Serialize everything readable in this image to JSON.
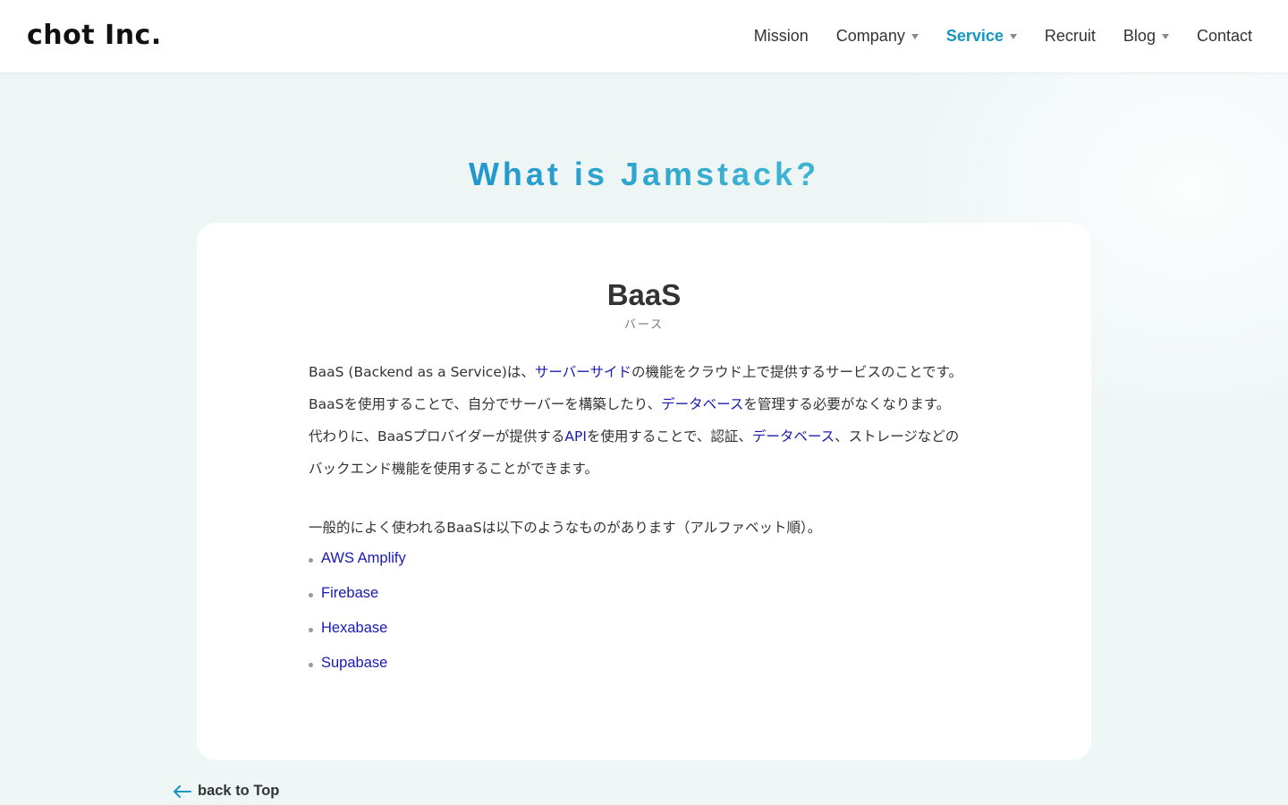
{
  "header": {
    "logo": "chot Inc.",
    "nav": [
      {
        "label": "Mission",
        "has_dropdown": false,
        "active": false
      },
      {
        "label": "Company",
        "has_dropdown": true,
        "active": false
      },
      {
        "label": "Service",
        "has_dropdown": true,
        "active": true
      },
      {
        "label": "Recruit",
        "has_dropdown": false,
        "active": false
      },
      {
        "label": "Blog",
        "has_dropdown": true,
        "active": false
      },
      {
        "label": "Contact",
        "has_dropdown": false,
        "active": false
      }
    ]
  },
  "hero": {
    "title": "What is Jamstack?"
  },
  "card": {
    "title": "BaaS",
    "ruby": "バース",
    "paragraphs": [
      {
        "pre": "BaaS (Backend as a Service)は、",
        "link": "サーバーサイド",
        "post": "の機能をクラウド上で提供するサービスのことです。"
      },
      {
        "pre": "BaaSを使用することで、自分でサーバーを構築したり、",
        "link": "データベース",
        "post": "を管理する必要がなくなります。"
      },
      {
        "pre": "代わりに、BaaSプロバイダーが提供する",
        "link": "API",
        "mid": "を使用することで、認証、",
        "link2": "データベース",
        "post": "、ストレージなどの"
      },
      {
        "text": "バックエンド機能を使用することができます。"
      }
    ],
    "list_intro": "一般的によく使われるBaaSは以下のようなものがあります（アルファベット順）。",
    "list": [
      "AWS Amplify",
      "Firebase",
      "Hexabase",
      "Supabase"
    ]
  },
  "footer_nav": {
    "back_label": "back to Top"
  },
  "colors": {
    "accent": "#1596c1",
    "link": "#1a1ab3",
    "background": "#eef5f5"
  }
}
